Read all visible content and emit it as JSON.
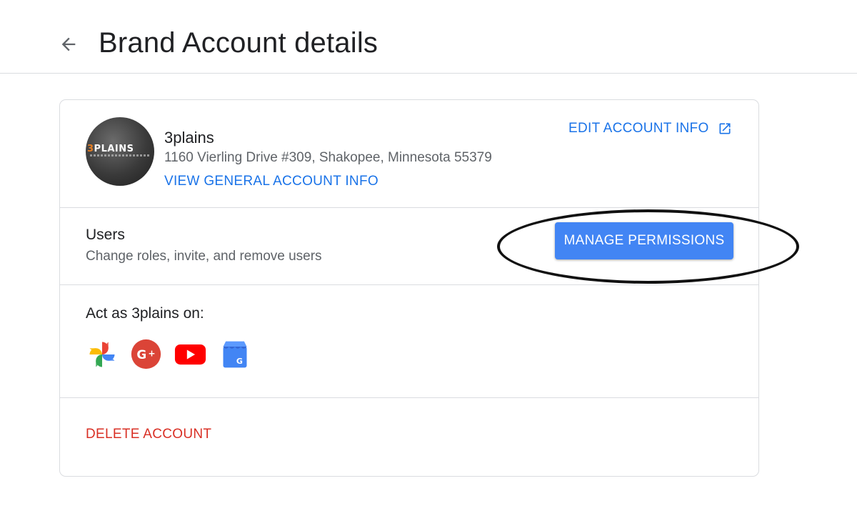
{
  "header": {
    "title": "Brand Account details",
    "back_icon": "arrow-back-icon"
  },
  "account": {
    "name": "3plains",
    "address": "1160 Vierling Drive #309, Shakopee, Minnesota 55379",
    "view_general_label": "VIEW GENERAL ACCOUNT INFO",
    "edit_info_label": "EDIT ACCOUNT INFO",
    "edit_info_icon": "open-in-new-icon",
    "avatar_logo_prefix": "3",
    "avatar_logo_text": "PLAINS"
  },
  "users": {
    "title": "Users",
    "subtitle": "Change roles, invite, and remove users",
    "manage_label": "MANAGE PERMISSIONS"
  },
  "act_as": {
    "title": "Act as 3plains on:",
    "apps": [
      {
        "name": "google-photos-icon"
      },
      {
        "name": "google-plus-icon"
      },
      {
        "name": "youtube-icon"
      },
      {
        "name": "google-my-business-icon"
      }
    ]
  },
  "danger": {
    "delete_label": "DELETE ACCOUNT"
  },
  "colors": {
    "link_blue": "#1a73e8",
    "button_blue": "#4285f4",
    "delete_red": "#d93025",
    "divider": "#dadce0"
  }
}
